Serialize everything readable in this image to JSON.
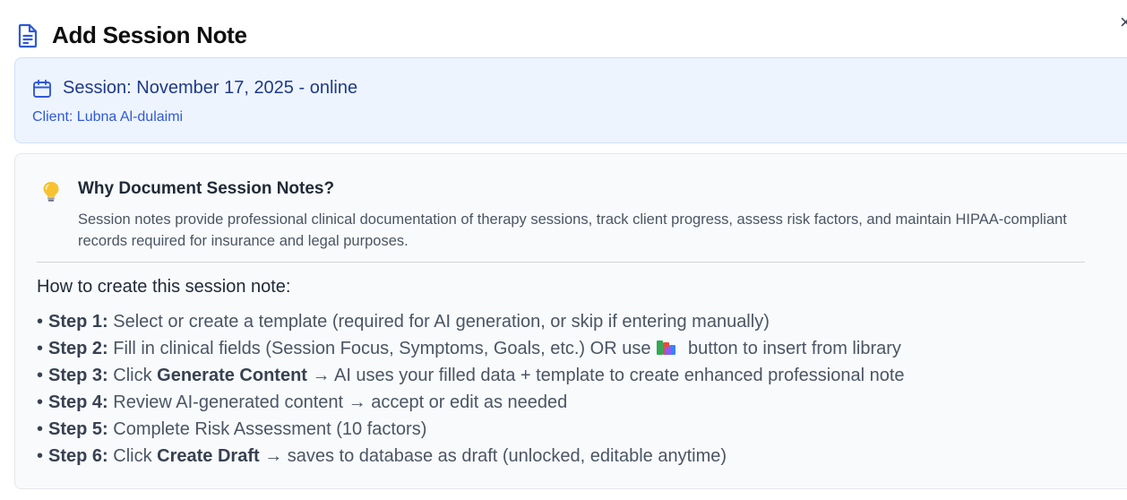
{
  "dialog": {
    "title": "Add Session Note",
    "close_glyph": "×",
    "title_icon": "document-icon"
  },
  "session": {
    "title": "Session: November 17, 2025 - online",
    "client": "Client: Lubna Al-dulaimi",
    "icon": "calendar-icon"
  },
  "why": {
    "icon": "lightbulb-icon",
    "title": "Why Document Session Notes?",
    "text": "Session notes provide professional clinical documentation of therapy sessions, track client progress, assess risk factors, and maintain HIPAA-compliant records required for insurance and legal purposes."
  },
  "how": {
    "title": "How to create this session note:",
    "bullet": "•",
    "steps": [
      {
        "label": "Step 1:",
        "before": " Select or create a template (required for AI generation, or skip if entering manually)"
      },
      {
        "label": "Step 2:",
        "before": " Fill in clinical fields (Session Focus, Symptoms, Goals, etc.) OR use",
        "icon": "books-icon",
        "after": " button to insert from library"
      },
      {
        "label": "Step 3:",
        "before": " Click ",
        "bold": "Generate Content",
        "after": " → AI uses your filled data + template to create enhanced professional note"
      },
      {
        "label": "Step 4:",
        "before": " Review AI-generated content → accept or edit as needed"
      },
      {
        "label": "Step 5:",
        "before": " Complete Risk Assessment (10 factors)"
      },
      {
        "label": "Step 6:",
        "before": " Click ",
        "bold": "Create Draft",
        "after": " → saves to database as draft (unlocked, editable anytime)"
      }
    ]
  },
  "colors": {
    "accent": "#2f5ad6",
    "session_bg": "#eef4fe",
    "info_bg": "#f8fafc"
  }
}
